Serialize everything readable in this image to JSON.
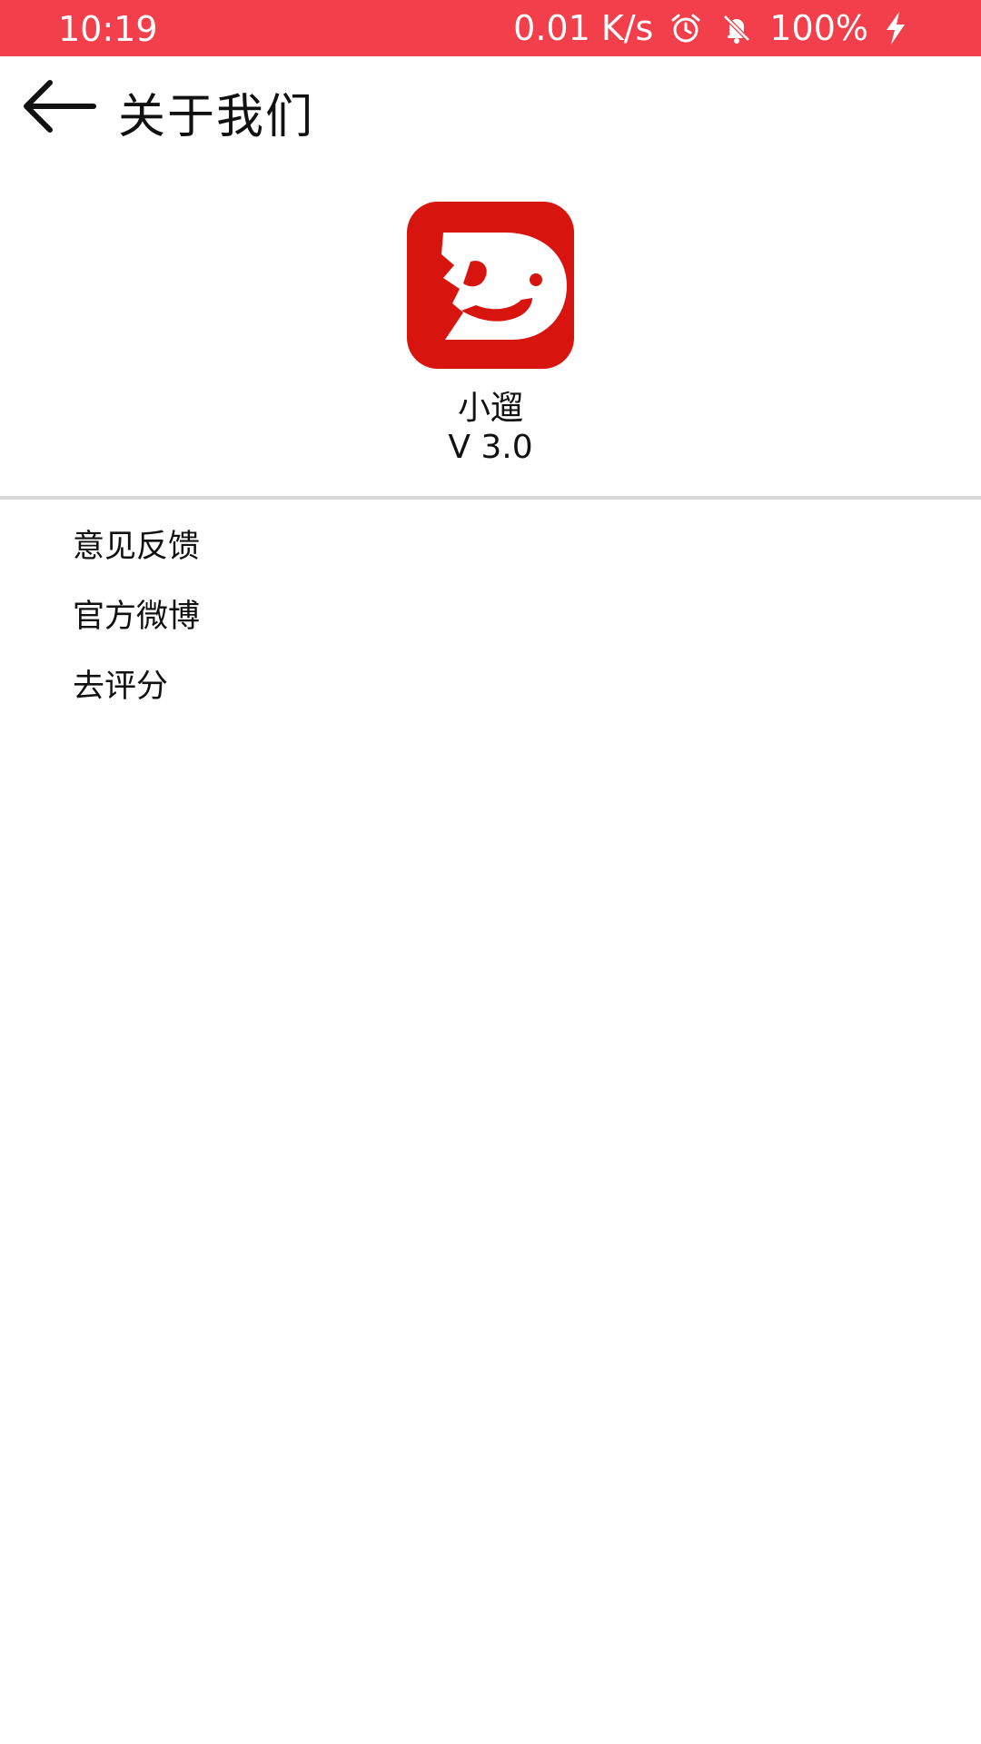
{
  "status_bar": {
    "time": "10:19",
    "network_speed": "0.01 K/s",
    "battery": "100%",
    "icons": [
      "alarm-icon",
      "notifications-off-icon",
      "charging-bolt-icon"
    ],
    "background_color": "#f33e4b"
  },
  "header": {
    "title": "关于我们",
    "back_icon": "arrow-left-icon"
  },
  "about": {
    "app_name": "小遛",
    "version": "V 3.0",
    "logo_color": "#d8140f"
  },
  "menu": {
    "items": [
      {
        "label": "意见反馈"
      },
      {
        "label": "官方微博"
      },
      {
        "label": "去评分"
      }
    ]
  }
}
